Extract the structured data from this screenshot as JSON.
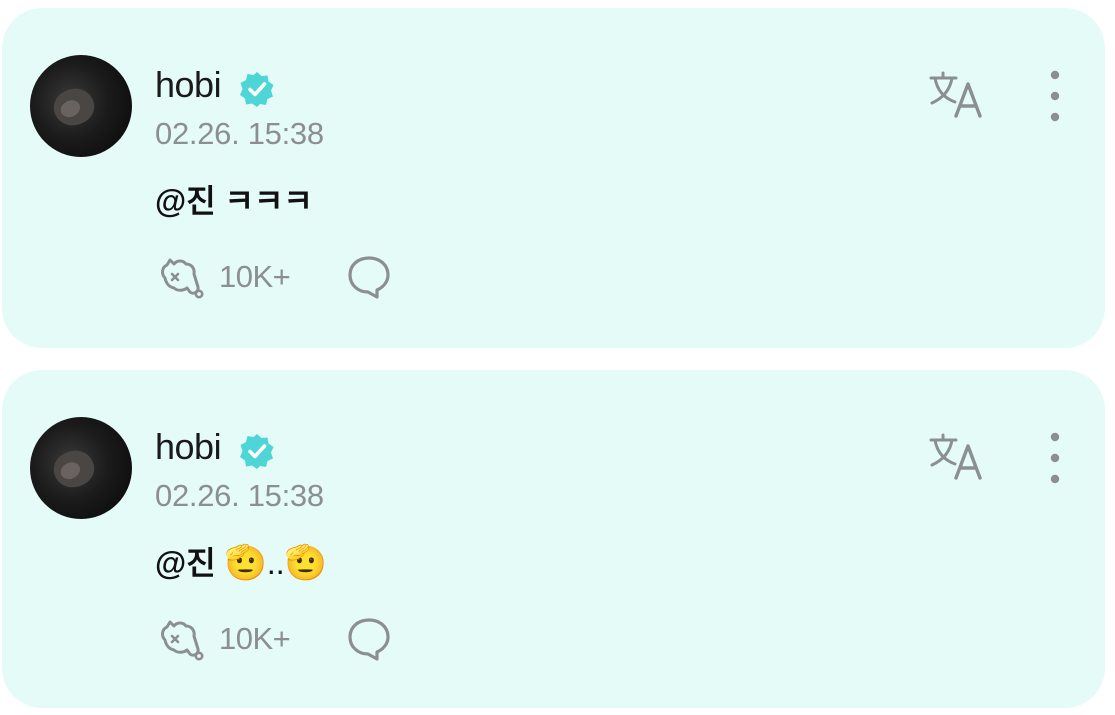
{
  "posts": [
    {
      "author": "hobi",
      "timestamp": "02.26. 15:38",
      "mention": "@진",
      "text": "ㅋㅋㅋ",
      "emojis": [],
      "cheer_count": "10K+"
    },
    {
      "author": "hobi",
      "timestamp": "02.26. 15:38",
      "mention": "@진",
      "text": "",
      "emojis": [
        "🫡",
        "🫡"
      ],
      "separator": "..",
      "cheer_count": "10K+"
    }
  ],
  "colors": {
    "card_bg": "#e4fbf8",
    "verified": "#4ed6d6",
    "muted_text": "#8c8f92",
    "icon": "#8c8f92"
  },
  "icons": {
    "verified": "verified-badge-icon",
    "cheer": "cheer-icon",
    "comment": "comment-icon",
    "translate": "translate-icon",
    "more": "more-vertical-icon"
  }
}
